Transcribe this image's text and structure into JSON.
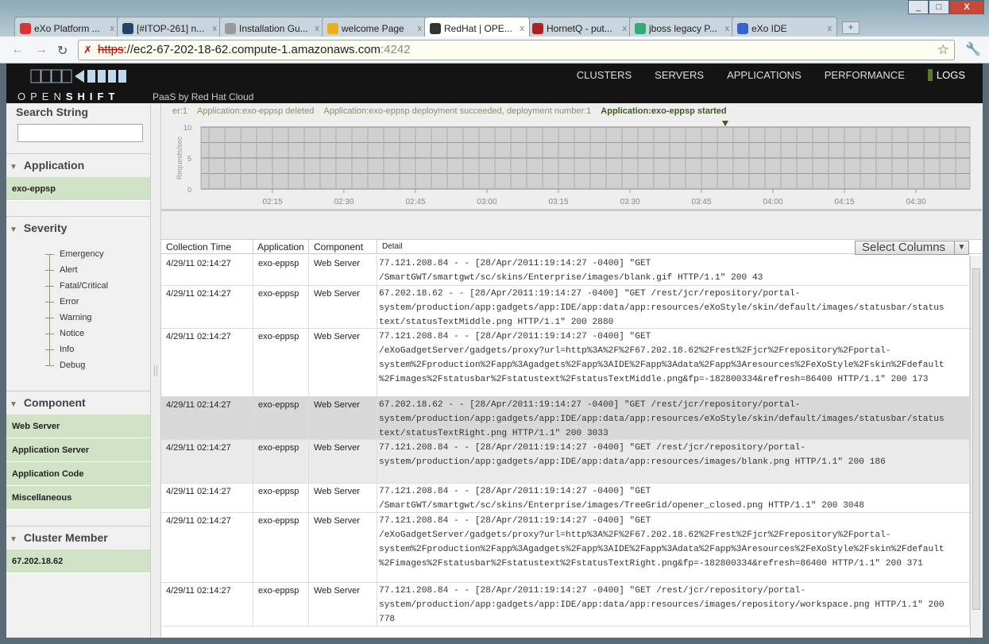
{
  "browser": {
    "tabs": [
      {
        "label": "eXo Platform ...",
        "icon": "gmail-icon",
        "color": "#d33"
      },
      {
        "label": "[#ITOP-261] n...",
        "icon": "jira-icon",
        "color": "#246"
      },
      {
        "label": "Installation Gu...",
        "icon": "page-icon",
        "color": "#999"
      },
      {
        "label": "welcome Page",
        "icon": "loading-icon",
        "color": "#e8b020"
      },
      {
        "label": "RedHat | OPE...",
        "icon": "openshift-icon",
        "color": "#333"
      },
      {
        "label": "HornetQ - put...",
        "icon": "hornetq-icon",
        "color": "#a22"
      },
      {
        "label": "jboss legacy P...",
        "icon": "google-icon",
        "color": "#3a7"
      },
      {
        "label": "eXo IDE",
        "icon": "exo-icon",
        "color": "#36c"
      }
    ],
    "url_scheme": "https",
    "url_host": "://ec2-67-202-18-62.compute-1.amazonaws.com",
    "url_port": ":4242"
  },
  "header": {
    "brand_light": "OPEN",
    "brand_bold": "SHIFT",
    "tagline": "PaaS by Red Hat Cloud",
    "menu": [
      "CLUSTERS",
      "SERVERS",
      "APPLICATIONS",
      "PERFORMANCE",
      "LOGS"
    ]
  },
  "sidebar": {
    "search_label": "Search String",
    "search_value": "",
    "application": {
      "title": "Application",
      "items": [
        "exo-eppsp"
      ]
    },
    "severity": {
      "title": "Severity",
      "levels": [
        "Emergency",
        "Alert",
        "Fatal/Critical",
        "Error",
        "Warning",
        "Notice",
        "Info",
        "Debug"
      ],
      "selected": "Debug"
    },
    "component": {
      "title": "Component",
      "items": [
        "Web Server",
        "Application Server",
        "Application Code",
        "Miscellaneous"
      ]
    },
    "cluster": {
      "title": "Cluster Member",
      "items": [
        "67.202.18.62"
      ]
    }
  },
  "events": [
    "er:1",
    "Application:exo-eppsp deleted",
    "Application:exo-eppsp deployment succeeded, deployment number:1",
    "Application:exo-eppsp started"
  ],
  "chart_data": {
    "type": "line",
    "ylabel": "Requests/sec",
    "ylim": [
      0,
      10
    ],
    "yticks": [
      "0",
      "5",
      "10"
    ],
    "xticks": [
      "02:15",
      "02:30",
      "02:45",
      "03:00",
      "03:15",
      "03:30",
      "03:45",
      "04:00",
      "04:15",
      "04:30"
    ],
    "series": [],
    "grid": true,
    "marker_at": "03:50"
  },
  "table": {
    "columns": [
      "Collection Time",
      "Application",
      "Component",
      "Detail"
    ],
    "select_columns": "Select Columns",
    "rows": [
      {
        "time": "4/29/11 02:14:27",
        "app": "exo-eppsp",
        "comp": "Web Server",
        "detail": "77.121.208.84 - - [28/Apr/2011:19:14:27 -0400] \"GET\n/SmartGWT/smartgwt/sc/skins/Enterprise/images/blank.gif HTTP/1.1\" 200 43"
      },
      {
        "time": "4/29/11 02:14:27",
        "app": "exo-eppsp",
        "comp": "Web Server",
        "detail": "67.202.18.62 - - [28/Apr/2011:19:14:27 -0400] \"GET /rest/jcr/repository/portal-\nsystem/production/app:gadgets/app:IDE/app:data/app:resources/eXoStyle/skin/default/images/statusbar/status\ntext/statusTextMiddle.png HTTP/1.1\" 200 2880"
      },
      {
        "time": "4/29/11 02:14:27",
        "app": "exo-eppsp",
        "comp": "Web Server",
        "detail": "77.121.208.84 - - [28/Apr/2011:19:14:27 -0400] \"GET\n/eXoGadgetServer/gadgets/proxy?url=http%3A%2F%2F67.202.18.62%2Frest%2Fjcr%2Frepository%2Fportal-\nsystem%2Fproduction%2Fapp%3Agadgets%2Fapp%3AIDE%2Fapp%3Adata%2Fapp%3Aresources%2FeXoStyle%2Fskin%2Fdefault\n%2Fimages%2Fstatusbar%2Fstatustext%2FstatusTextMiddle.png&fp=-182800334&refresh=86400 HTTP/1.1\" 200 173"
      },
      {
        "time": "4/29/11 02:14:27",
        "app": "exo-eppsp",
        "comp": "Web Server",
        "detail": "67.202.18.62 - - [28/Apr/2011:19:14:27 -0400] \"GET /rest/jcr/repository/portal-\nsystem/production/app:gadgets/app:IDE/app:data/app:resources/eXoStyle/skin/default/images/statusbar/status\ntext/statusTextRight.png HTTP/1.1\" 200 3033"
      },
      {
        "time": "4/29/11 02:14:27",
        "app": "exo-eppsp",
        "comp": "Web Server",
        "detail": "77.121.208.84 - - [28/Apr/2011:19:14:27 -0400] \"GET /rest/jcr/repository/portal-\nsystem/production/app:gadgets/app:IDE/app:data/app:resources/images/blank.png HTTP/1.1\" 200 186"
      },
      {
        "time": "4/29/11 02:14:27",
        "app": "exo-eppsp",
        "comp": "Web Server",
        "detail": "77.121.208.84 - - [28/Apr/2011:19:14:27 -0400] \"GET\n/SmartGWT/smartgwt/sc/skins/Enterprise/images/TreeGrid/opener_closed.png HTTP/1.1\" 200 3048"
      },
      {
        "time": "4/29/11 02:14:27",
        "app": "exo-eppsp",
        "comp": "Web Server",
        "detail": "77.121.208.84 - - [28/Apr/2011:19:14:27 -0400] \"GET\n/eXoGadgetServer/gadgets/proxy?url=http%3A%2F%2F67.202.18.62%2Frest%2Fjcr%2Frepository%2Fportal-\nsystem%2Fproduction%2Fapp%3Agadgets%2Fapp%3AIDE%2Fapp%3Adata%2Fapp%3Aresources%2FeXoStyle%2Fskin%2Fdefault\n%2Fimages%2Fstatusbar%2Fstatustext%2FstatusTextRight.png&fp=-182800334&refresh=86400 HTTP/1.1\" 200 371"
      },
      {
        "time": "4/29/11 02:14:27",
        "app": "exo-eppsp",
        "comp": "Web Server",
        "detail": "77.121.208.84 - - [28/Apr/2011:19:14:27 -0400] \"GET /rest/jcr/repository/portal-\nsystem/production/app:gadgets/app:IDE/app:data/app:resources/images/repository/workspace.png HTTP/1.1\" 200\n778"
      }
    ],
    "selected_row": 3
  }
}
